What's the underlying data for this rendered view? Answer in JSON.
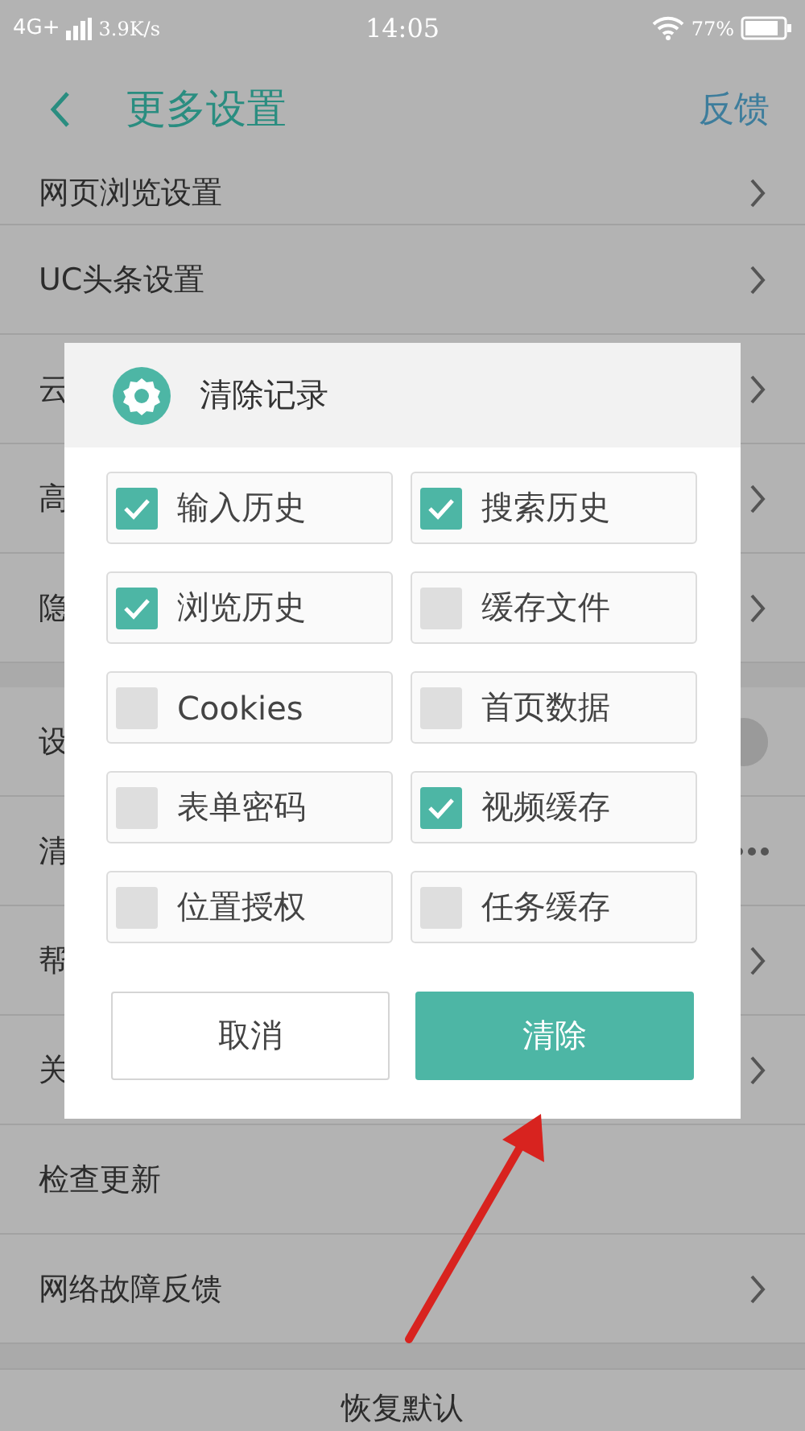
{
  "status_bar": {
    "network": "4G+",
    "speed": "3.9K/s",
    "time": "14:05",
    "battery": "77%"
  },
  "header": {
    "title": "更多设置",
    "action": "反馈"
  },
  "sections": [
    {
      "rows": [
        {
          "label": "网页浏览设置",
          "kind": "chevron"
        },
        {
          "label": "UC头条设置",
          "kind": "chevron"
        },
        {
          "label": "云",
          "kind": "chevron"
        },
        {
          "label": "高",
          "kind": "chevron"
        },
        {
          "label": "隐",
          "kind": "chevron"
        }
      ]
    },
    {
      "rows": [
        {
          "label": "设",
          "kind": "toggle",
          "on": true
        },
        {
          "label": "清",
          "kind": "more"
        },
        {
          "label": "帮",
          "kind": "chevron"
        },
        {
          "label": "关",
          "kind": "chevron"
        },
        {
          "label": "检查更新",
          "kind": "plain"
        },
        {
          "label": "网络故障反馈",
          "kind": "chevron"
        }
      ]
    },
    {
      "rows": [
        {
          "label": "恢复默认",
          "kind": "centered"
        }
      ]
    }
  ],
  "dialog": {
    "title": "清除记录",
    "options": [
      {
        "label": "输入历史",
        "checked": true
      },
      {
        "label": "搜索历史",
        "checked": true
      },
      {
        "label": "浏览历史",
        "checked": true
      },
      {
        "label": "缓存文件",
        "checked": false
      },
      {
        "label": "Cookies",
        "checked": false
      },
      {
        "label": "首页数据",
        "checked": false
      },
      {
        "label": "表单密码",
        "checked": false
      },
      {
        "label": "视频缓存",
        "checked": true
      },
      {
        "label": "位置授权",
        "checked": false
      },
      {
        "label": "任务缓存",
        "checked": false
      }
    ],
    "buttons": [
      {
        "label": "取消",
        "kind": "secondary"
      },
      {
        "label": "清除",
        "kind": "primary"
      }
    ]
  }
}
